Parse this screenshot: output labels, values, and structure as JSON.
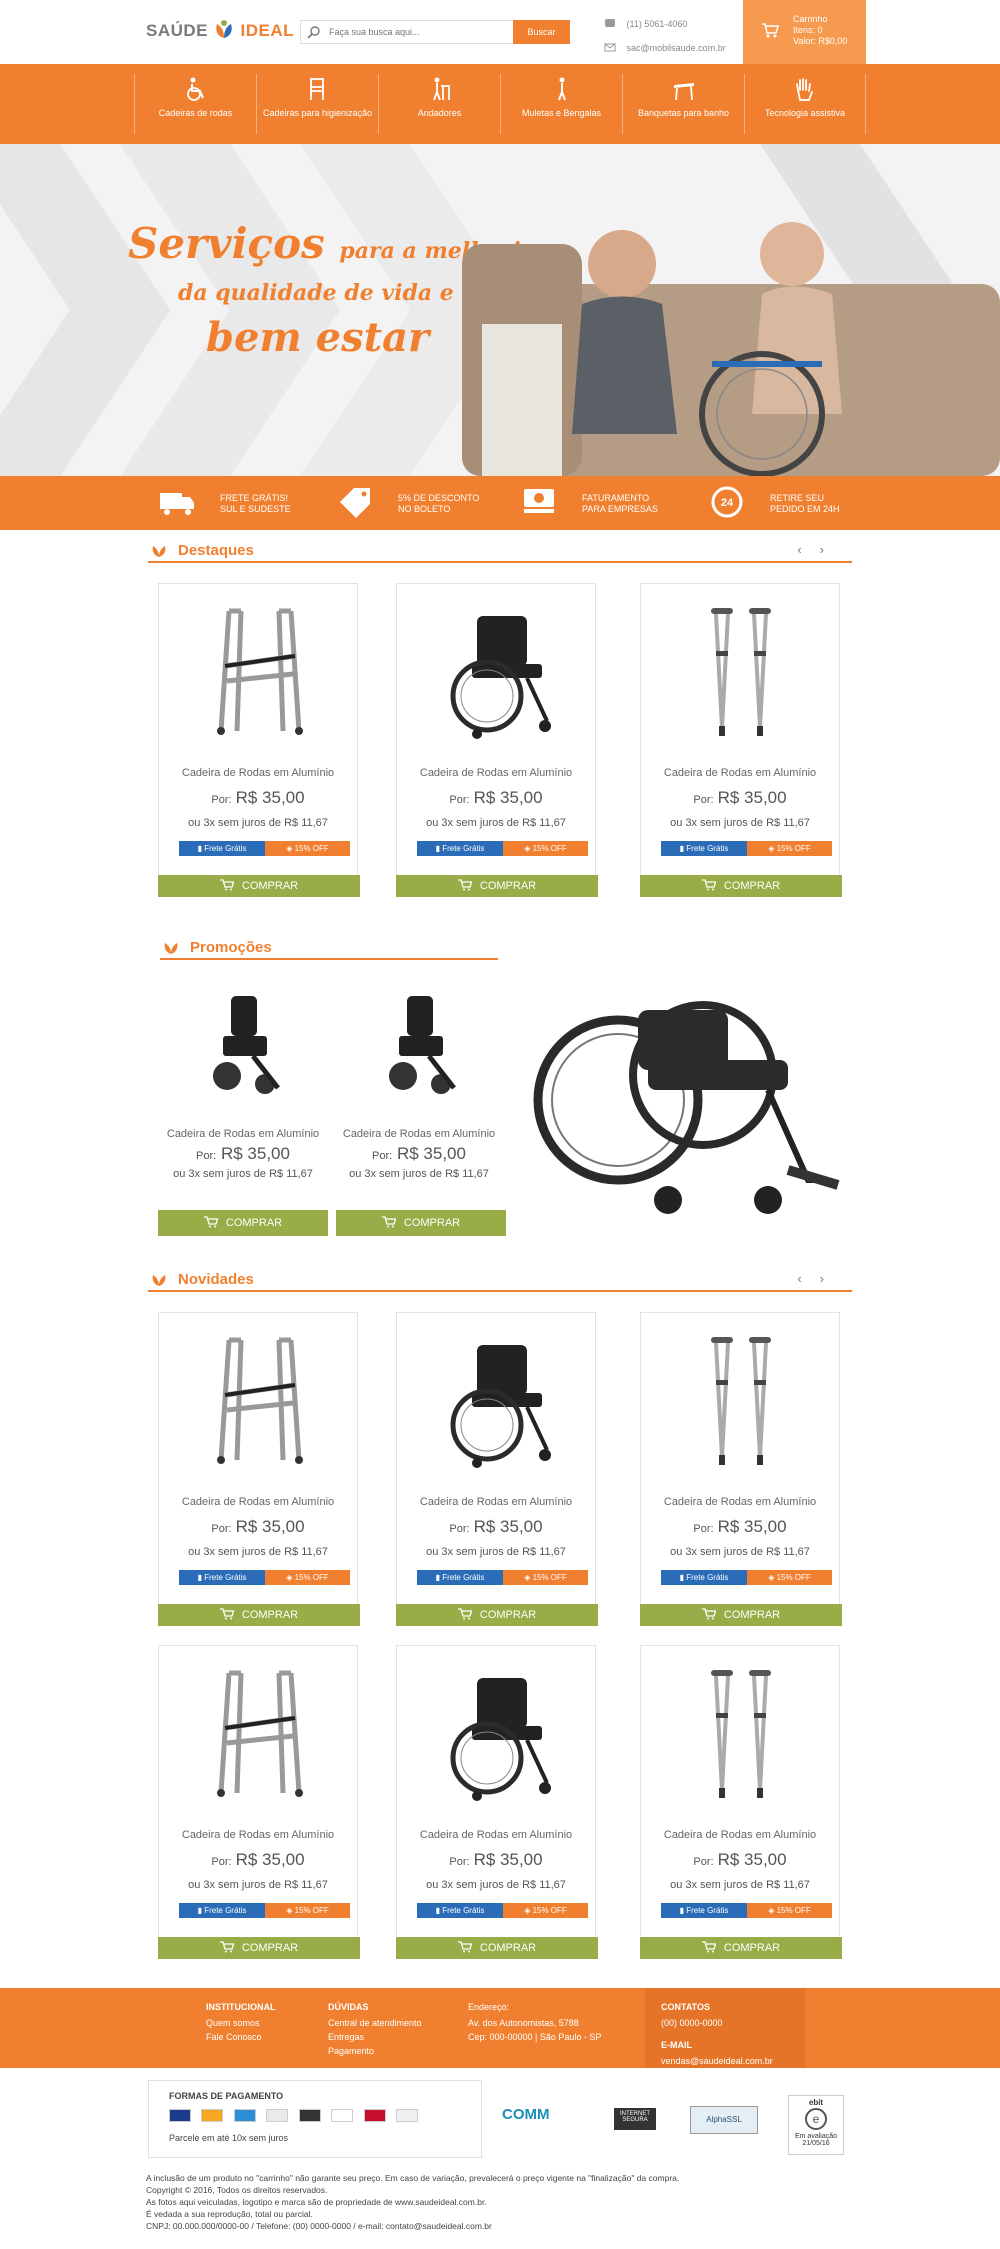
{
  "header": {
    "logo_part1": "SAÚDE",
    "logo_part2": "IDEAL",
    "search_placeholder": "Faça sua busca aqui...",
    "search_button": "Buscar",
    "phone": "(11) 5061-4060",
    "email": "sac@mobilsaude.com.br",
    "cart_title": "Carrinho",
    "cart_items": "Itens: 0",
    "cart_value": "Valor: R$0,00"
  },
  "nav": [
    {
      "label": "Cadeiras de rodas",
      "icon": "wheelchair-icon"
    },
    {
      "label": "Cadeiras para higienização",
      "icon": "hygiene-chair-icon"
    },
    {
      "label": "Andadores",
      "icon": "walker-icon"
    },
    {
      "label": "Muletas e Bengalas",
      "icon": "crutch-icon"
    },
    {
      "label": "Banquetas para banho",
      "icon": "bath-stool-icon"
    },
    {
      "label": "Tecnologia assistiva",
      "icon": "hand-icon"
    }
  ],
  "banner": {
    "line1_big": "Serviços",
    "line1_small": "para a melhoria",
    "line2": "da qualidade de vida e",
    "line3": "bem estar"
  },
  "features": [
    {
      "line1": "FRETE GRÁTIS!",
      "line2": "SUL E SUDESTE",
      "icon": "truck-icon"
    },
    {
      "line1": "5% DE DESCONTO",
      "line2": "NO BOLETO",
      "icon": "tag-icon"
    },
    {
      "line1": "FATURAMENTO",
      "line2": "PARA EMPRESAS",
      "icon": "money-icon"
    },
    {
      "line1": "RETIRE SEU",
      "line2": "PEDIDO EM 24H",
      "icon": "clock-24-icon"
    }
  ],
  "sections": {
    "destaques": "Destaques",
    "promocoes": "Promoções",
    "novidades": "Novidades"
  },
  "product": {
    "name": "Cadeira de Rodas em Alumínio",
    "por": "Por:",
    "price": "R$ 35,00",
    "installments": "ou 3x sem juros de R$ 11,67",
    "frete": "Frete Grátis",
    "off": "15% OFF",
    "buy": "COMPRAR"
  },
  "footer": {
    "institucional_title": "INSTITUCIONAL",
    "institucional_1": "Quem somos",
    "institucional_2": "Fale Conosco",
    "duvidas_title": "DÚVIDAS",
    "duvidas_1": "Central de atendimento",
    "duvidas_2": "Entregas",
    "duvidas_3": "Pagamento",
    "endereco_title": "Endereço:",
    "endereco_1": "Av. dos Autonomistas, 5788",
    "endereco_2": "Cep: 000-00000 | São Paulo - SP",
    "contatos_title": "CONTATOS",
    "contatos_phone": "(00) 0000-0000",
    "email_title": "E-MAIL",
    "email_value": "vendas@saudeideal.com.br"
  },
  "payment": {
    "title": "FORMAS DE PAGAMENTO",
    "parcele": "Parcele em até 10x sem juros",
    "comm": "COMM",
    "internet": "INTERNET SEGURA",
    "ssl": "AlphaSSL",
    "ebit": "ebit",
    "ebit_eval": "Em avaliação",
    "ebit_date": "21/05/16"
  },
  "legal": [
    "A inclusão de um produto no \"carrinho\" não garante seu preço. Em caso de variação, prevalecerá o preço vigente na \"finalização\" da compra.",
    "Copyright © 2016, Todos os direitos reservados.",
    "As fotos aqui veiculadas, logotipo e marca são de propriedade de www.saudeideal.com.br.",
    "É vedada a sua reprodução, total ou parcial.",
    "CNPJ: 00.000.000/0000-00 / Telefone: (00) 0000-0000 / e-mail: contato@saudeideal.com.br"
  ]
}
